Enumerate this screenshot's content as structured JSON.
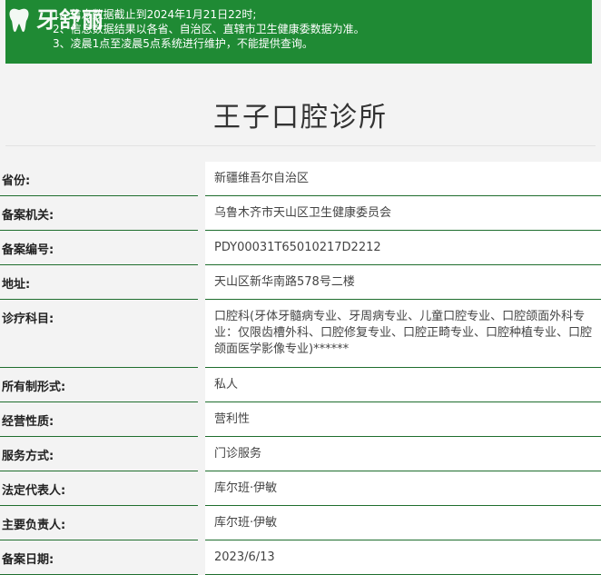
{
  "logo": {
    "text": "牙舒丽"
  },
  "notice": {
    "lines": [
      "1、信息数据截止到2024年1月21日22时;",
      "2、信息数据结果以各省、自治区、直辖市卫生健康委数据为准。",
      "3、凌晨1点至凌晨5点系统进行维护，不能提供查询。"
    ]
  },
  "clinic": {
    "name": "王子口腔诊所"
  },
  "fields": [
    {
      "label": "省份:",
      "value": "新疆维吾尔自治区"
    },
    {
      "label": "备案机关:",
      "value": "乌鲁木齐市天山区卫生健康委员会"
    },
    {
      "label": "备案编号:",
      "value": "PDY00031T65010217D2212"
    },
    {
      "label": "地址:",
      "value": "天山区新华南路578号二楼"
    },
    {
      "label": "诊疗科目:",
      "value": "口腔科(牙体牙髓病专业、牙周病专业、儿童口腔专业、口腔颌面外科专业：仅限齿槽外科、口腔修复专业、口腔正畸专业、口腔种植专业、口腔颌面医学影像专业)******"
    },
    {
      "label": "所有制形式:",
      "value": "私人"
    },
    {
      "label": "经营性质:",
      "value": "营利性"
    },
    {
      "label": "服务方式:",
      "value": "门诊服务"
    },
    {
      "label": "法定代表人:",
      "value": "库尔班·伊敏"
    },
    {
      "label": "主要负责人:",
      "value": "库尔班·伊敏"
    },
    {
      "label": "备案日期:",
      "value": "2023/6/13"
    }
  ],
  "colors": {
    "notice_bg": "#1f8a34",
    "row_border": "#1f6e2e"
  }
}
